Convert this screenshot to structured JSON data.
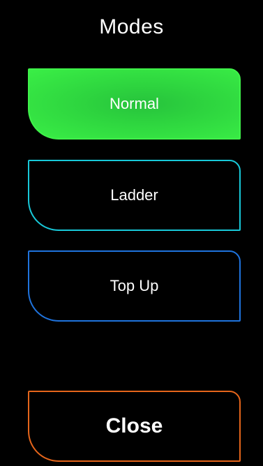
{
  "title": "Modes",
  "modes": {
    "normal": {
      "label": "Normal",
      "selected": true,
      "color": "#3ff24a"
    },
    "ladder": {
      "label": "Ladder",
      "selected": false,
      "color": "#18c9d9"
    },
    "top_up": {
      "label": "Top Up",
      "selected": false,
      "color": "#1f73dd"
    }
  },
  "close": {
    "label": "Close",
    "color": "#e5651b"
  }
}
